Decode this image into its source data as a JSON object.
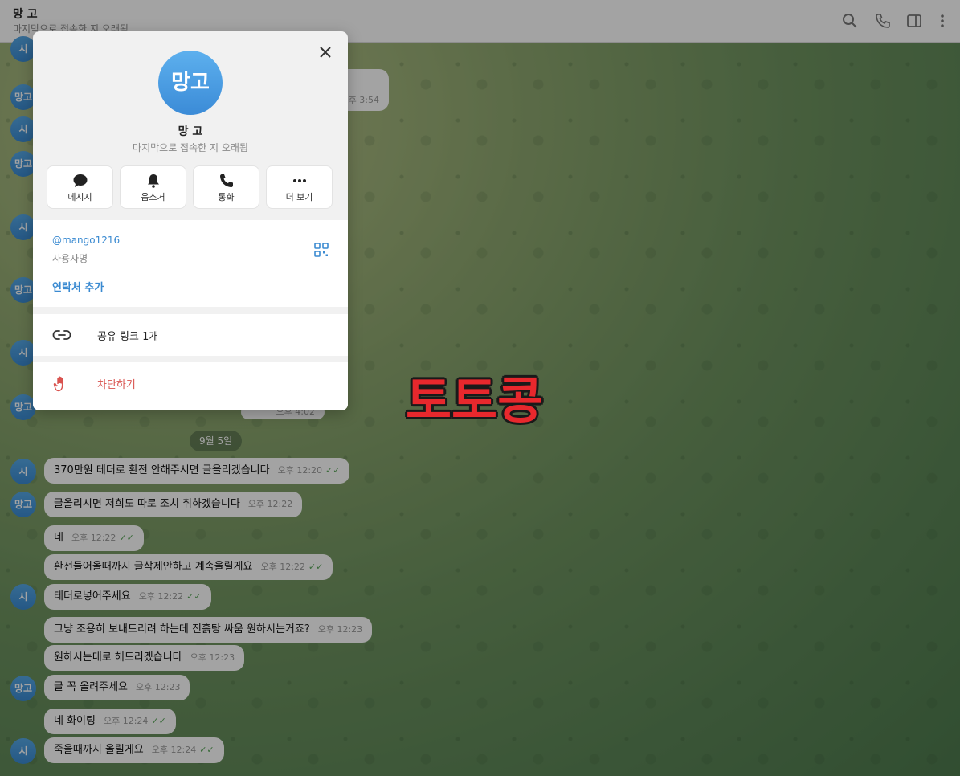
{
  "header": {
    "title": "망 고",
    "subtitle": "마지막으로 접속한 지 오래됨"
  },
  "date_separator": "9월 5일",
  "watermark": "토토콩",
  "left_avatars_top": [
    "시",
    "망고",
    "시",
    "망고",
    "시",
    "망고",
    "시",
    "망고"
  ],
  "hidden_bubbles": {
    "time_a": "오후 3:54",
    "time_b": "오후 4:02"
  },
  "messages": [
    {
      "text": "370만원 테더로 환전 안해주시면 글올리겠습니다",
      "time": "오후 12:20",
      "ticks": "✓✓"
    },
    {
      "text": "글올리시면 저희도 따로 조치 취하겠습니다",
      "time": "오후 12:22",
      "ticks": ""
    },
    {
      "text": "네",
      "time": "오후 12:22",
      "ticks": "✓✓"
    },
    {
      "text": "환전들어올때까지 글삭제안하고 계속올릴게요",
      "time": "오후 12:22",
      "ticks": "✓✓"
    },
    {
      "text": "테더로넣어주세요",
      "time": "오후 12:22",
      "ticks": "✓✓"
    },
    {
      "text": "그냥 조용히 보내드리려 하는데 진흙탕 싸움 원하시는거죠?",
      "time": "오후 12:23",
      "ticks": ""
    },
    {
      "text": "원하시는대로 해드리겠습니다",
      "time": "오후 12:23",
      "ticks": ""
    },
    {
      "text": "글 꼭 올려주세요",
      "time": "오후 12:23",
      "ticks": ""
    },
    {
      "text": "네 화이팅",
      "time": "오후 12:24",
      "ticks": "✓✓"
    },
    {
      "text": "죽을때까지 올릴게요",
      "time": "오후 12:24",
      "ticks": "✓✓"
    }
  ],
  "avatars": {
    "si": "시",
    "mango": "망고"
  },
  "profile": {
    "avatar_text": "망고",
    "name": "망 고",
    "status": "마지막으로 접속한 지 오래됨",
    "actions": [
      {
        "label": "메시지",
        "icon": "message-icon"
      },
      {
        "label": "음소거",
        "icon": "bell-icon"
      },
      {
        "label": "통화",
        "icon": "phone-icon"
      },
      {
        "label": "더 보기",
        "icon": "more-icon"
      }
    ],
    "username": "@mango1216",
    "username_label": "사용자명",
    "add_contact": "연락처 추가",
    "share_link": "공유 링크 1개",
    "block": "차단하기"
  },
  "colors": {
    "accent": "#3a8ad1",
    "danger": "#d9534f",
    "tick": "#5aa65a",
    "watermark": "#e8282d"
  }
}
